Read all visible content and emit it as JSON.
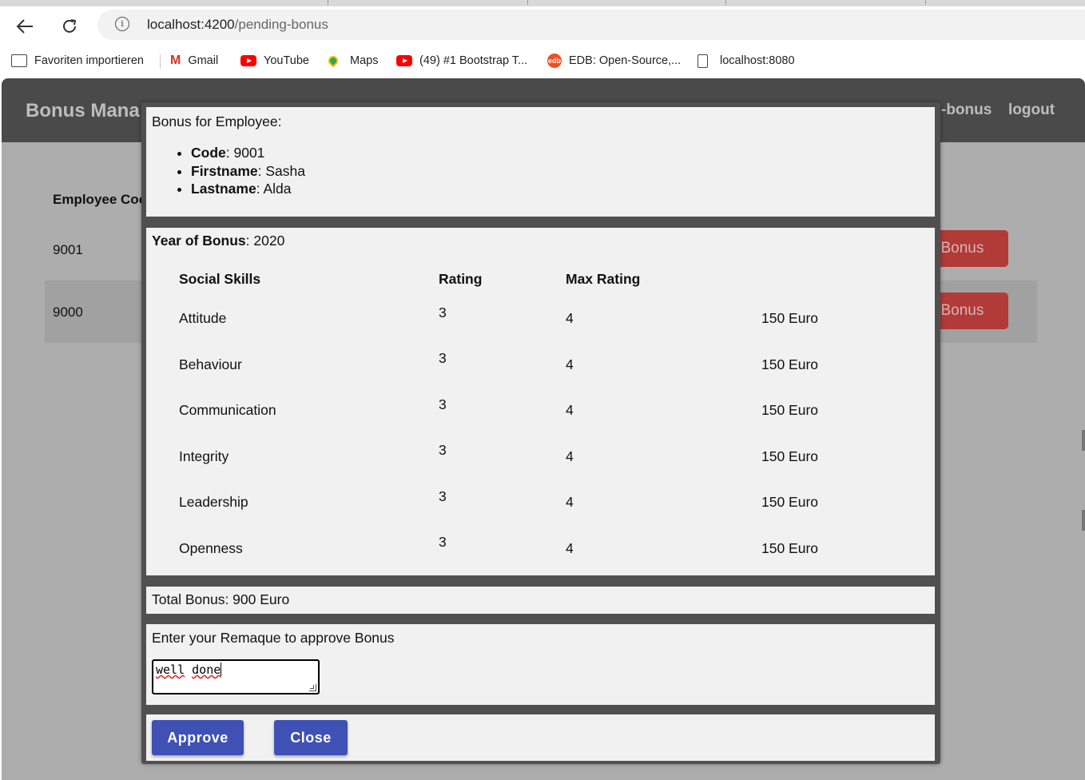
{
  "browser": {
    "url_host": "localhost:4200",
    "url_path": "/pending-bonus",
    "bookmarks": [
      {
        "label": "Favoriten importieren",
        "icon": "import-favorites-icon"
      },
      {
        "label": "Gmail",
        "icon": "gmail-icon"
      },
      {
        "label": "YouTube",
        "icon": "youtube-icon"
      },
      {
        "label": "Maps",
        "icon": "maps-pin-icon"
      },
      {
        "label": "(49) #1 Bootstrap T...",
        "icon": "youtube-icon"
      },
      {
        "label": "EDB: Open-Source,...",
        "icon": "edb-icon"
      },
      {
        "label": "localhost:8080",
        "icon": "document-icon"
      }
    ]
  },
  "app": {
    "title": "Bonus Mana",
    "nav": [
      "-bonus",
      "logout"
    ],
    "table_header": "Employee Coc",
    "rows": [
      {
        "code": "9001",
        "button": "l Bonus"
      },
      {
        "code": "9000",
        "button": "l Bonus"
      }
    ]
  },
  "modal": {
    "employee_heading": "Bonus for Employee:",
    "employee": [
      {
        "key": "Code",
        "value": ": 9001"
      },
      {
        "key": "Firstname",
        "value": ": Sasha"
      },
      {
        "key": "Lastname",
        "value": ": Alda"
      }
    ],
    "year_label": "Year of Bonus",
    "year_value": ": 2020",
    "skills_headers": {
      "skill": "Social Skills",
      "rating": "Rating",
      "max": "Max Rating"
    },
    "skills": [
      {
        "name": "Attitude",
        "rating": "3",
        "max": "4",
        "amount": "150 Euro"
      },
      {
        "name": "Behaviour",
        "rating": "3",
        "max": "4",
        "amount": "150 Euro"
      },
      {
        "name": "Communication",
        "rating": "3",
        "max": "4",
        "amount": "150 Euro"
      },
      {
        "name": "Integrity",
        "rating": "3",
        "max": "4",
        "amount": "150 Euro"
      },
      {
        "name": "Leadership",
        "rating": "3",
        "max": "4",
        "amount": "150 Euro"
      },
      {
        "name": "Openness",
        "rating": "3",
        "max": "4",
        "amount": "150 Euro"
      }
    ],
    "total": "Total Bonus: 900 Euro",
    "remark_label": "Enter your Remaque to approve Bonus",
    "remark_words": [
      "well",
      "done"
    ],
    "approve_label": "Approve",
    "close_label": "Close"
  },
  "colors": {
    "primary_button": "#3f51b5",
    "danger_button": "#b23a37",
    "app_bar": "#4a4a4a",
    "overlay": "#adadad"
  }
}
